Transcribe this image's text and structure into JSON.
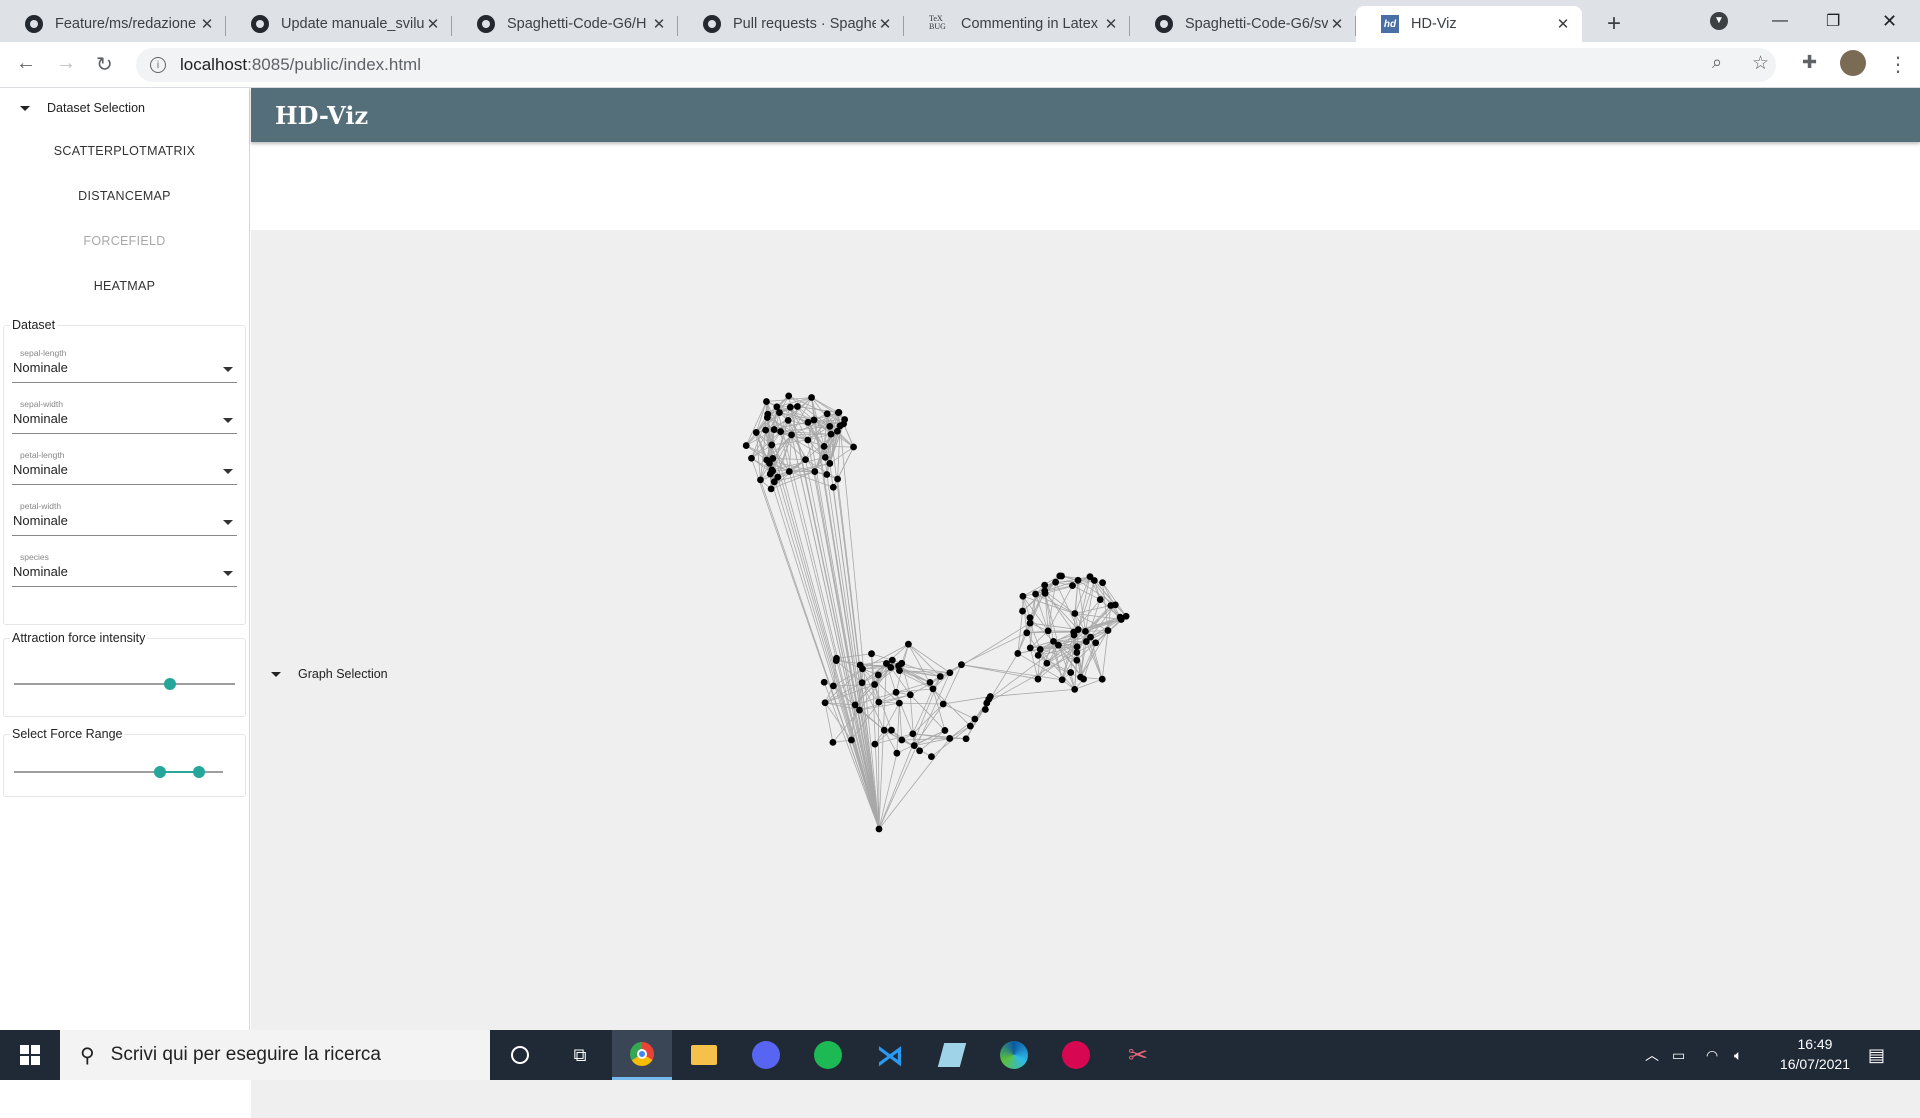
{
  "browser": {
    "tabs": [
      {
        "title": "Feature/ms/redazione",
        "icon": "github-icon"
      },
      {
        "title": "Update manuale_svilu",
        "icon": "github-icon"
      },
      {
        "title": "Spaghetti-Code-G6/H",
        "icon": "github-icon"
      },
      {
        "title": "Pull requests · Spaghe",
        "icon": "github-icon"
      },
      {
        "title": "Commenting in Latex",
        "icon": "tex-icon"
      },
      {
        "title": "Spaghetti-Code-G6/sv",
        "icon": "github-icon"
      },
      {
        "title": "HD-Viz",
        "icon": "hdviz-icon",
        "active": true
      }
    ],
    "url": "localhost:8085/public/index.html",
    "url_host": "localhost",
    "url_rest": ":8085/public/index.html"
  },
  "app": {
    "title": "HD-Viz",
    "header_color": "#546e7a",
    "accent": "#26a69a"
  },
  "sidebar": {
    "dataset_selection": "Dataset Selection",
    "graph_selection": "Graph Selection",
    "graph_buttons": [
      {
        "label": "SCATTERPLOTMATRIX",
        "disabled": false
      },
      {
        "label": "DISTANCEMAP",
        "disabled": false
      },
      {
        "label": "FORCEFIELD",
        "disabled": true
      },
      {
        "label": "HEATMAP",
        "disabled": false
      }
    ],
    "dataset_legend": "Dataset",
    "dimensions": [
      {
        "label": "sepal-length",
        "value": "Nominale"
      },
      {
        "label": "sepal-width",
        "value": "Nominale"
      },
      {
        "label": "petal-length",
        "value": "Nominale"
      },
      {
        "label": "petal-width",
        "value": "Nominale"
      },
      {
        "label": "species",
        "value": "Nominale"
      }
    ],
    "attraction_legend": "Attraction force intensity",
    "attraction_value": 0.7,
    "range_legend": "Select Force Range",
    "range_values": [
      0.7,
      0.88
    ]
  },
  "taskbar": {
    "search_placeholder": "Scrivi qui per eseguire la ricerca",
    "time": "16:49",
    "date": "16/07/2021",
    "apps": [
      "cortana-icon",
      "task-view-icon",
      "chrome-icon",
      "file-explorer-icon",
      "discord-icon",
      "spotify-icon",
      "vscode-icon",
      "notepad-icon",
      "edge-icon",
      "debian-icon",
      "snipping-icon"
    ]
  }
}
